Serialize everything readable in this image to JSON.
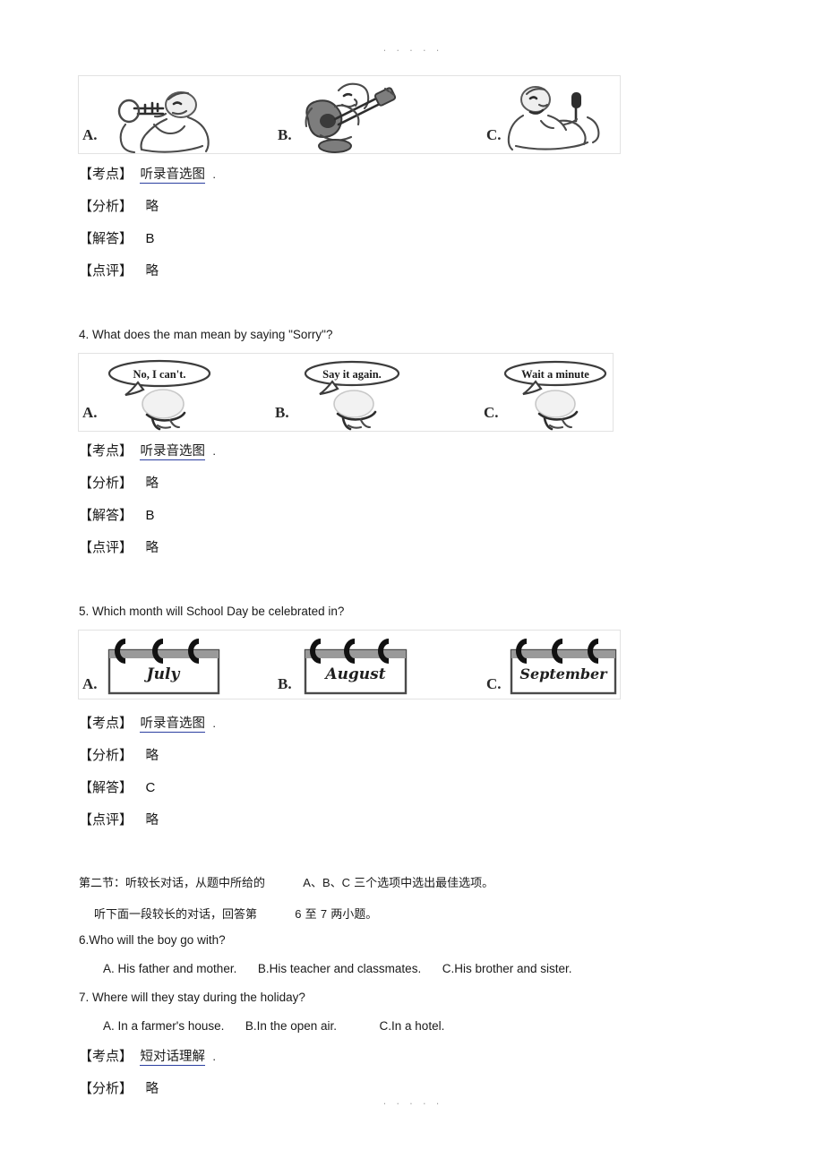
{
  "page": {
    "separator_top": "· · · · ·",
    "separator_bottom": "· · · · ·"
  },
  "blocks": [
    {
      "id": "q3",
      "stem": "",
      "image": {
        "caption": "three cartoon musicians",
        "options": [
          {
            "letter": "A.",
            "icon": "trumpet-player-icon",
            "alt": "man playing a trumpet"
          },
          {
            "letter": "B.",
            "icon": "guitar-player-icon",
            "alt": "person playing a guitar"
          },
          {
            "letter": "C.",
            "icon": "singer-microphone-icon",
            "alt": "man singing into a microphone"
          }
        ]
      },
      "explanation": {
        "kaodian_tag": "【考点】",
        "kaodian_link": "听录音选图",
        "kaodian_dot": ".",
        "fenxi_tag": "【分析】",
        "fenxi_value": "略",
        "jieda_tag": "【解答】",
        "jieda_value": "B",
        "dianping_tag": "【点评】",
        "dianping_value": "略"
      }
    },
    {
      "id": "q4",
      "stem": "4. What does the man mean by saying \"Sorry\"?",
      "image": {
        "caption": "three cartoon heads with speech bubbles",
        "options": [
          {
            "letter": "A.",
            "icon": "speech-bubble-icon",
            "bubble": "No, I can't."
          },
          {
            "letter": "B.",
            "icon": "speech-bubble-icon",
            "bubble": "Say it again."
          },
          {
            "letter": "C.",
            "icon": "speech-bubble-icon",
            "bubble": "Wait a minute"
          }
        ]
      },
      "explanation": {
        "kaodian_tag": "【考点】",
        "kaodian_link": "听录音选图",
        "kaodian_dot": ".",
        "fenxi_tag": "【分析】",
        "fenxi_value": "略",
        "jieda_tag": "【解答】",
        "jieda_value": "B",
        "dianping_tag": "【点评】",
        "dianping_value": "略"
      }
    },
    {
      "id": "q5",
      "stem": "5. Which month will School Day be celebrated in?",
      "image": {
        "caption": "three spiral-bound wall calendars",
        "options": [
          {
            "letter": "A.",
            "icon": "calendar-icon",
            "month": "July"
          },
          {
            "letter": "B.",
            "icon": "calendar-icon",
            "month": "August"
          },
          {
            "letter": "C.",
            "icon": "calendar-icon",
            "month": "September"
          }
        ]
      },
      "explanation": {
        "kaodian_tag": "【考点】",
        "kaodian_link": "听录音选图",
        "kaodian_dot": ".",
        "fenxi_tag": "【分析】",
        "fenxi_value": "略",
        "jieda_tag": "【解答】",
        "jieda_value": "C",
        "dianping_tag": "【点评】",
        "dianping_value": "略"
      }
    }
  ],
  "section_two": {
    "directions_1a": "第二节：听较长对话，从题中所给的",
    "directions_1b": "A、B、C",
    "directions_1c": "三个选项中选出最佳选项。",
    "directions_2a": "听下面一段较长的对话，回答第",
    "directions_2b": "6",
    "directions_2c": "至",
    "directions_2d": "7",
    "directions_2e": "两小题。",
    "questions": [
      {
        "stem": "6.Who will the boy go with?",
        "choices": [
          "A. His father and mother.",
          "B.His teacher and classmates.",
          "C.His brother and sister."
        ]
      },
      {
        "stem": "7.  Where will they stay during the holiday?",
        "choices": [
          "A. In a farmer's house.",
          "B.In the open air.",
          "C.In a hotel."
        ]
      }
    ],
    "explanation": {
      "kaodian_tag": "【考点】",
      "kaodian_link": "短对话理解",
      "kaodian_dot": ".",
      "fenxi_tag": "【分析】",
      "fenxi_value": "略"
    }
  },
  "colors": {
    "link_underline": "#2b3fa0",
    "panel_border": "#e2e2e2",
    "text": "#1a1a1a",
    "separator": "#9a9a9a"
  }
}
